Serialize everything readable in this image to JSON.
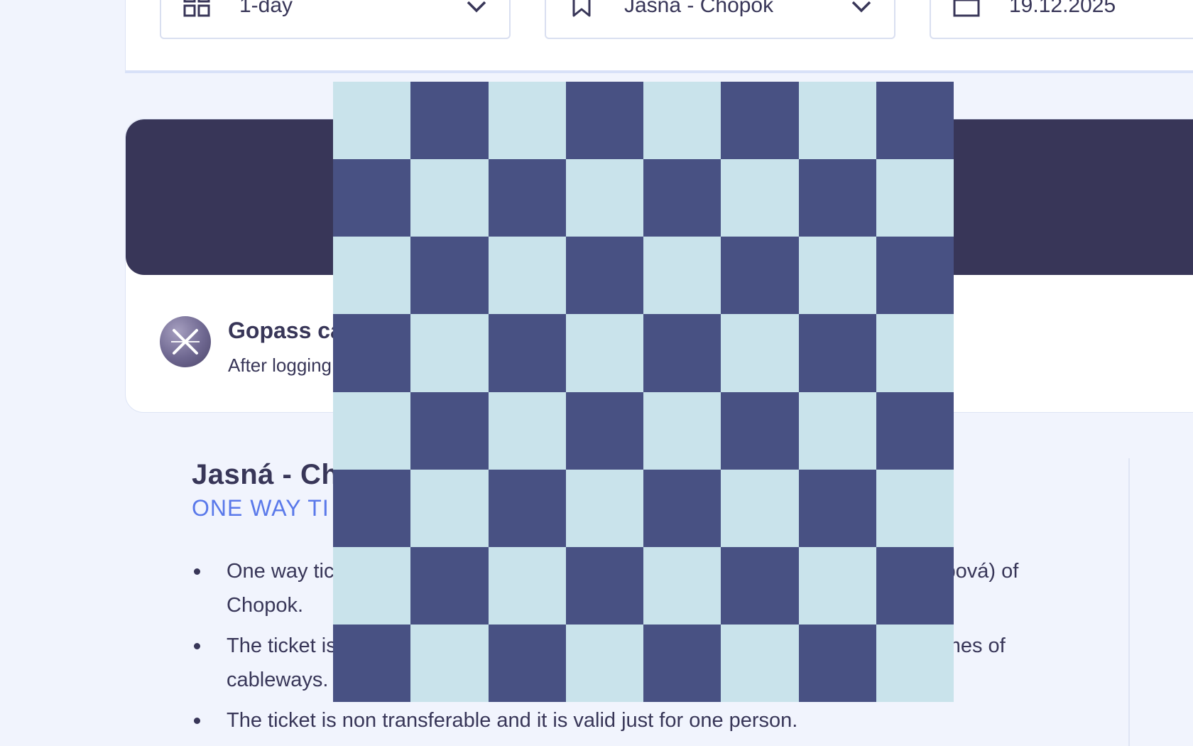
{
  "selectors": [
    {
      "value": "1-day",
      "icon": "grid-icon"
    },
    {
      "value": "Jasná - Chopok",
      "icon": "bookmark-icon"
    },
    {
      "value": "19.12.2025",
      "icon": "calendar-icon"
    }
  ],
  "gopass": {
    "title": "Gopass ca",
    "subtitle": "After logging"
  },
  "product": {
    "title": "Jasná - Ch",
    "subtitle": "ONE WAY TI",
    "bullets": [
      {
        "start": "One way tic",
        "end": "pová) of",
        "cont": "Chopok."
      },
      {
        "start": "The ticket is",
        "end": "mes of",
        "cont": "cableways."
      },
      {
        "text": "The ticket is non transferable and it is valid just for one person."
      }
    ]
  },
  "colors": {
    "navy": "#383658",
    "accent": "#5a79ea",
    "background": "#f1f4fd",
    "checker_dark": "#485183",
    "checker_light": "#c9e3eb"
  }
}
